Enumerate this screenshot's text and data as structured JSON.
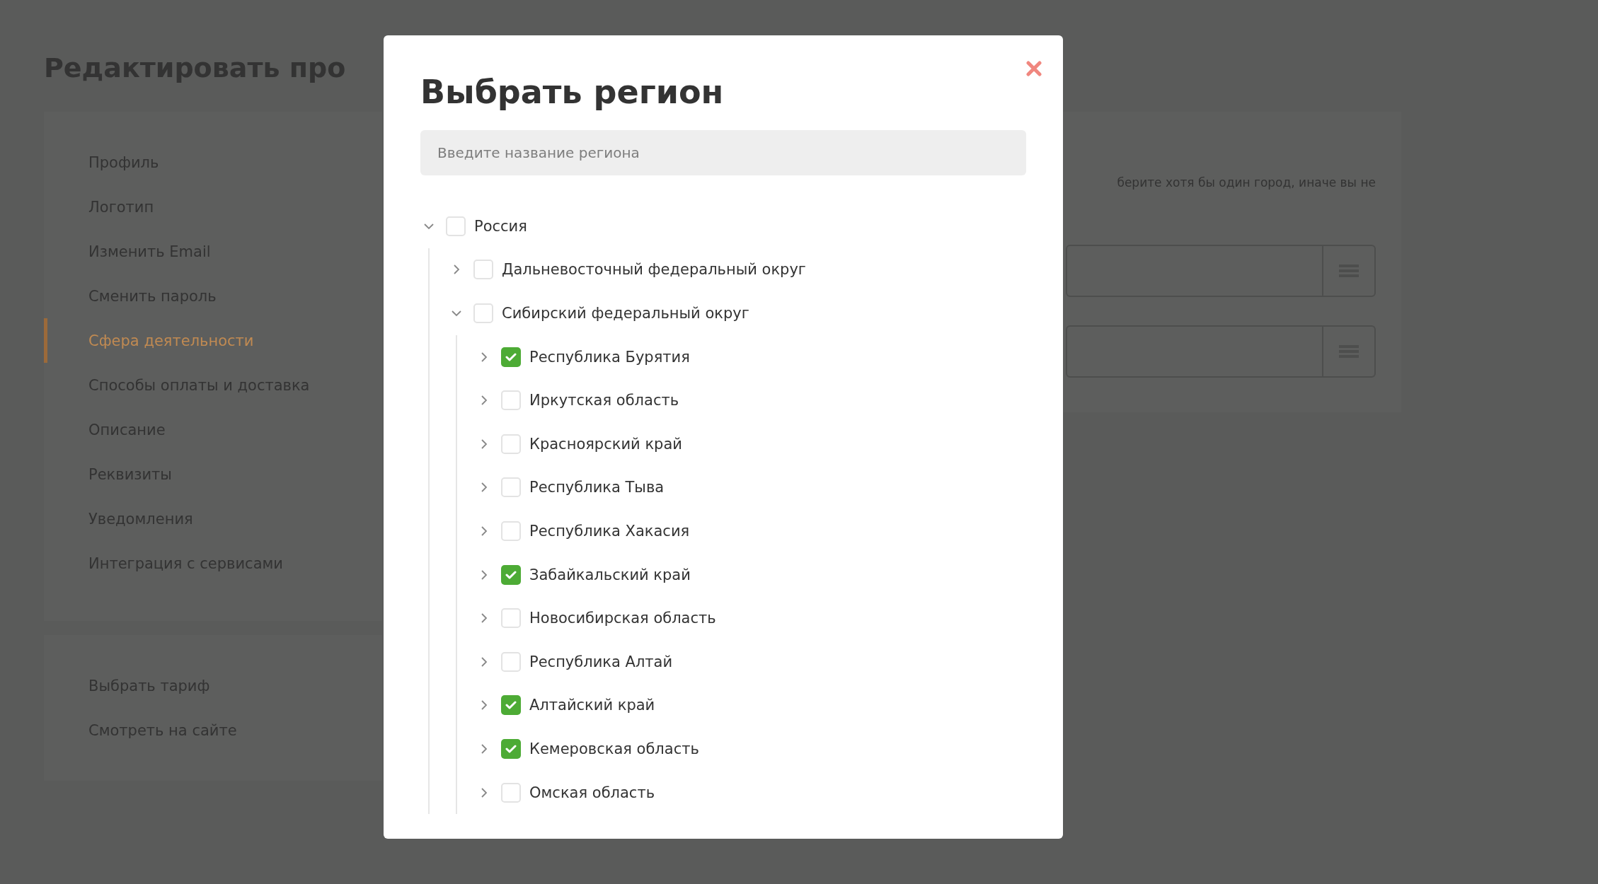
{
  "page": {
    "title": "Редактировать про"
  },
  "sidebar": {
    "items": [
      {
        "label": "Профиль",
        "selected": false
      },
      {
        "label": "Логотип",
        "selected": false
      },
      {
        "label": "Изменить Email",
        "selected": false
      },
      {
        "label": "Сменить пароль",
        "selected": false
      },
      {
        "label": "Сфера деятельности",
        "selected": true
      },
      {
        "label": "Способы оплаты и доставка",
        "selected": false
      },
      {
        "label": "Описание",
        "selected": false
      },
      {
        "label": "Реквизиты",
        "selected": false
      },
      {
        "label": "Уведомления",
        "selected": false
      },
      {
        "label": "Интеграция с сервисами",
        "selected": false
      }
    ],
    "links": [
      "Выбрать тариф",
      "Смотреть на сайте"
    ]
  },
  "content": {
    "hint": "берите хотя бы один город, иначе вы не",
    "fields": [
      {
        "kind": "select"
      },
      {
        "kind": "select"
      }
    ]
  },
  "modal": {
    "title": "Выбрать регион",
    "search": {
      "placeholder": "Введите название региона"
    },
    "tree": [
      {
        "label": "Россия",
        "checked": false,
        "expanded": true,
        "children": [
          {
            "label": "Дальневосточный федеральный округ",
            "checked": false,
            "expanded": false
          },
          {
            "label": "Сибирский федеральный округ",
            "checked": false,
            "expanded": true,
            "children": [
              {
                "label": "Республика Бурятия",
                "checked": true,
                "expanded": false
              },
              {
                "label": "Иркутская область",
                "checked": false,
                "expanded": false
              },
              {
                "label": "Красноярский край",
                "checked": false,
                "expanded": false
              },
              {
                "label": "Республика Тыва",
                "checked": false,
                "expanded": false
              },
              {
                "label": "Республика Хакасия",
                "checked": false,
                "expanded": false
              },
              {
                "label": "Забайкальский край",
                "checked": true,
                "expanded": false
              },
              {
                "label": "Новосибирская область",
                "checked": false,
                "expanded": false
              },
              {
                "label": "Республика Алтай",
                "checked": false,
                "expanded": false
              },
              {
                "label": "Алтайский край",
                "checked": true,
                "expanded": false
              },
              {
                "label": "Кемеровская область",
                "checked": true,
                "expanded": false
              },
              {
                "label": "Омская область",
                "checked": false,
                "expanded": false
              }
            ]
          }
        ]
      }
    ]
  }
}
